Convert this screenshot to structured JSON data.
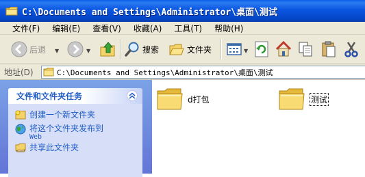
{
  "window": {
    "title": "C:\\Documents and Settings\\Administrator\\桌面\\测试"
  },
  "menu": [
    "文件(F)",
    "编辑(E)",
    "查看(V)",
    "收藏(A)",
    "工具(T)",
    "帮助(H)"
  ],
  "toolbar": {
    "back_label": "后退",
    "search_label": "搜索",
    "folders_label": "文件夹"
  },
  "address": {
    "label": "地址(D)",
    "value": "C:\\Documents and Settings\\Administrator\\桌面\\测试"
  },
  "task_panel": {
    "title": "文件和文件夹任务",
    "tasks": [
      {
        "label": "创建一个新文件夹"
      },
      {
        "label": "将这个文件夹发布到",
        "sub": "Web"
      },
      {
        "label": "共享此文件夹"
      }
    ]
  },
  "files": [
    {
      "name": "d打包"
    },
    {
      "name": "测试"
    }
  ],
  "colors": {
    "title_bar": "#0a55e0",
    "task_pane": "#6f8fe0",
    "task_link": "#215dc6",
    "folder": "#f7d769"
  }
}
